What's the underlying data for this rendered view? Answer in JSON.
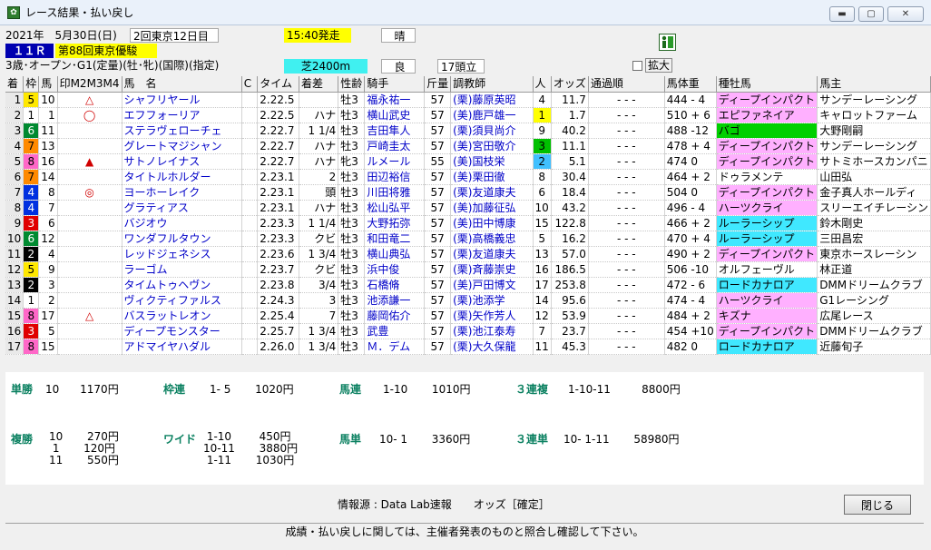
{
  "window": {
    "title": "レース結果・払い戻し",
    "min": "▬",
    "max": "▢",
    "close": "✕"
  },
  "race": {
    "date": "2021年　5月30日(日)",
    "meeting": "2回東京12日目",
    "start": "15:40発走",
    "weather": "晴",
    "race_no": "１１Ｒ",
    "race_name": "第88回東京優駿",
    "conditions": "3歳･オープン･G1(定量)(牡･牝)(国際)(指定)",
    "course": "芝2400m",
    "going": "良",
    "runners": "17頭立",
    "rank_label": "拡大"
  },
  "colors": {
    "gate1": "#ffffff",
    "gate2": "#000000",
    "gate3": "#e00000",
    "gate4": "#0030e0",
    "gate5": "#ffe800",
    "gate6": "#008a30",
    "gate7": "#ff8a00",
    "gate8": "#ff68c8"
  },
  "headers": [
    "着",
    "枠",
    "馬",
    "印M2M3M4",
    "馬　名",
    "C",
    "タイム",
    "着差",
    "性齢",
    "騎手",
    "斤量",
    "調教師",
    "人",
    "オッズ",
    "通過順",
    "馬体重",
    "種牡馬",
    "馬主"
  ],
  "rows": [
    {
      "pos": "1",
      "gate": "5",
      "num": "10",
      "mark": "△",
      "name": "シャフリヤール",
      "time": "2.22.5",
      "margin": "",
      "sa": "牡3",
      "jockey": "福永祐一",
      "wt": "57",
      "trainer": "(栗)藤原英昭",
      "pop": "4",
      "odds": "11.7",
      "pass": "-  -  -",
      "body": "444 - 4",
      "sire": "ディープインパクト",
      "sire_color": "#ffb0ff",
      "owner": "サンデーレーシング"
    },
    {
      "pos": "2",
      "gate": "1",
      "num": "1",
      "mark": "◯",
      "name": "エフフォーリア",
      "time": "2.22.5",
      "margin": "ハナ",
      "sa": "牡3",
      "jockey": "横山武史",
      "wt": "57",
      "trainer": "(美)鹿戸雄一",
      "pop": "1",
      "pop_color": "#ffff00",
      "odds": "1.7",
      "pass": "-  -  -",
      "body": "510 + 6",
      "sire": "エピファネイア",
      "sire_color": "#ffb0ff",
      "owner": "キャロットファーム"
    },
    {
      "pos": "3",
      "gate": "6",
      "num": "11",
      "mark": "",
      "name": "ステラヴェローチェ",
      "time": "2.22.7",
      "margin": "1 1/4",
      "sa": "牡3",
      "jockey": "吉田隼人",
      "wt": "57",
      "trainer": "(栗)須貝尚介",
      "pop": "9",
      "odds": "40.2",
      "pass": "-  -  -",
      "body": "488 -12",
      "sire": "バゴ",
      "sire_color": "#00d000",
      "owner": "大野剛嗣"
    },
    {
      "pos": "4",
      "gate": "7",
      "num": "13",
      "mark": "",
      "name": "グレートマジシャン",
      "time": "2.22.7",
      "margin": "ハナ",
      "sa": "牡3",
      "jockey": "戸崎圭太",
      "wt": "57",
      "trainer": "(美)宮田敬介",
      "pop": "3",
      "pop_color": "#00c000",
      "odds": "11.1",
      "pass": "-  -  -",
      "body": "478 + 4",
      "sire": "ディープインパクト",
      "sire_color": "#ffb0ff",
      "owner": "サンデーレーシング"
    },
    {
      "pos": "5",
      "gate": "8",
      "num": "16",
      "mark": "▲",
      "name": "サトノレイナス",
      "time": "2.22.7",
      "margin": "ハナ",
      "sa": "牝3",
      "jockey": "ルメール",
      "wt": "55",
      "trainer": "(美)国枝栄",
      "pop": "2",
      "pop_color": "#40c0ff",
      "odds": "5.1",
      "pass": "-  -  -",
      "body": "474   0",
      "sire": "ディープインパクト",
      "sire_color": "#ffb0ff",
      "owner": "サトミホースカンパニ"
    },
    {
      "pos": "6",
      "gate": "7",
      "num": "14",
      "mark": "",
      "name": "タイトルホルダー",
      "time": "2.23.1",
      "margin": "2",
      "sa": "牡3",
      "jockey": "田辺裕信",
      "wt": "57",
      "trainer": "(美)栗田徹",
      "pop": "8",
      "odds": "30.4",
      "pass": "-  -  -",
      "body": "464 + 2",
      "sire": "ドゥラメンテ",
      "sire_color": "#ffffff",
      "owner": "山田弘"
    },
    {
      "pos": "7",
      "gate": "4",
      "num": "8",
      "mark": "◎",
      "name": "ヨーホーレイク",
      "time": "2.23.1",
      "margin": "頭",
      "sa": "牡3",
      "jockey": "川田将雅",
      "wt": "57",
      "trainer": "(栗)友道康夫",
      "pop": "6",
      "odds": "18.4",
      "pass": "-  -  -",
      "body": "504   0",
      "sire": "ディープインパクト",
      "sire_color": "#ffb0ff",
      "owner": "金子真人ホールディ"
    },
    {
      "pos": "8",
      "gate": "4",
      "num": "7",
      "mark": "",
      "name": "グラティアス",
      "time": "2.23.1",
      "margin": "ハナ",
      "sa": "牡3",
      "jockey": "松山弘平",
      "wt": "57",
      "trainer": "(美)加藤征弘",
      "pop": "10",
      "odds": "43.2",
      "pass": "-  -  -",
      "body": "496 - 4",
      "sire": "ハーツクライ",
      "sire_color": "#ffb0ff",
      "owner": "スリーエイチレーシン"
    },
    {
      "pos": "9",
      "gate": "3",
      "num": "6",
      "mark": "",
      "name": "バジオウ",
      "time": "2.23.3",
      "margin": "1 1/4",
      "sa": "牡3",
      "jockey": "大野拓弥",
      "wt": "57",
      "trainer": "(美)田中博康",
      "pop": "15",
      "odds": "122.8",
      "pass": "-  -  -",
      "body": "466 + 2",
      "sire": "ルーラーシップ",
      "sire_color": "#40e8ff",
      "owner": "鈴木剛史"
    },
    {
      "pos": "10",
      "gate": "6",
      "num": "12",
      "mark": "",
      "name": "ワンダフルタウン",
      "time": "2.23.3",
      "margin": "クビ",
      "sa": "牡3",
      "jockey": "和田竜二",
      "wt": "57",
      "trainer": "(栗)高橋義忠",
      "pop": "5",
      "odds": "16.2",
      "pass": "-  -  -",
      "body": "470 + 4",
      "sire": "ルーラーシップ",
      "sire_color": "#40e8ff",
      "owner": "三田昌宏"
    },
    {
      "pos": "11",
      "gate": "2",
      "num": "4",
      "mark": "",
      "name": "レッドジェネシス",
      "time": "2.23.6",
      "margin": "1 3/4",
      "sa": "牡3",
      "jockey": "横山典弘",
      "wt": "57",
      "trainer": "(栗)友道康夫",
      "pop": "13",
      "odds": "57.0",
      "pass": "-  -  -",
      "body": "490 + 2",
      "sire": "ディープインパクト",
      "sire_color": "#ffb0ff",
      "owner": "東京ホースレーシン"
    },
    {
      "pos": "12",
      "gate": "5",
      "num": "9",
      "mark": "",
      "name": "ラーゴム",
      "time": "2.23.7",
      "margin": "クビ",
      "sa": "牡3",
      "jockey": "浜中俊",
      "wt": "57",
      "trainer": "(栗)斉藤崇史",
      "pop": "16",
      "odds": "186.5",
      "pass": "-  -  -",
      "body": "506 -10",
      "sire": "オルフェーヴル",
      "sire_color": "#ffffff",
      "owner": "林正道"
    },
    {
      "pos": "13",
      "gate": "2",
      "num": "3",
      "mark": "",
      "name": "タイムトゥヘヴン",
      "time": "2.23.8",
      "margin": "3/4",
      "sa": "牡3",
      "jockey": "石橋脩",
      "wt": "57",
      "trainer": "(美)戸田博文",
      "pop": "17",
      "odds": "253.8",
      "pass": "-  -  -",
      "body": "472 - 6",
      "sire": "ロードカナロア",
      "sire_color": "#40e8ff",
      "owner": "DMMドリームクラブ"
    },
    {
      "pos": "14",
      "gate": "1",
      "num": "2",
      "mark": "",
      "name": "ヴィクティファルス",
      "time": "2.24.3",
      "margin": "3",
      "sa": "牡3",
      "jockey": "池添謙一",
      "wt": "57",
      "trainer": "(栗)池添学",
      "pop": "14",
      "odds": "95.6",
      "pass": "-  -  -",
      "body": "474 - 4",
      "sire": "ハーツクライ",
      "sire_color": "#ffb0ff",
      "owner": "G1レーシング"
    },
    {
      "pos": "15",
      "gate": "8",
      "num": "17",
      "mark": "△",
      "name": "バスラットレオン",
      "time": "2.25.4",
      "margin": "7",
      "sa": "牡3",
      "jockey": "藤岡佑介",
      "wt": "57",
      "trainer": "(栗)矢作芳人",
      "pop": "12",
      "odds": "53.9",
      "pass": "-  -  -",
      "body": "484 + 2",
      "sire": "キズナ",
      "sire_color": "#ffb0ff",
      "owner": "広尾レース"
    },
    {
      "pos": "16",
      "gate": "3",
      "num": "5",
      "mark": "",
      "name": "ディープモンスター",
      "time": "2.25.7",
      "margin": "1 3/4",
      "sa": "牡3",
      "jockey": "武豊",
      "wt": "57",
      "trainer": "(栗)池江泰寿",
      "pop": "7",
      "odds": "23.7",
      "pass": "-  -  -",
      "body": "454 +10",
      "sire": "ディープインパクト",
      "sire_color": "#ffb0ff",
      "owner": "DMMドリームクラブ"
    },
    {
      "pos": "17",
      "gate": "8",
      "num": "15",
      "mark": "",
      "name": "アドマイヤハダル",
      "time": "2.26.0",
      "margin": "1 3/4",
      "sa": "牡3",
      "jockey": "Ｍ．デム",
      "wt": "57",
      "trainer": "(栗)大久保龍",
      "pop": "11",
      "odds": "45.3",
      "pass": "-  -  -",
      "body": "482   0",
      "sire": "ロードカナロア",
      "sire_color": "#40e8ff",
      "owner": "近藤旬子"
    }
  ],
  "payout": {
    "tansho": {
      "label": "単勝",
      "lines": "10      1170円"
    },
    "wakuren": {
      "label": "枠連",
      "lines": "1- 5       1020円"
    },
    "umaren": {
      "label": "馬連",
      "lines": "1-10       1010円"
    },
    "sanrenpuku": {
      "label": "３連複",
      "lines": "1-10-11         8800円"
    },
    "fukusho": {
      "label": "複勝",
      "lines": "10       270円\n 1       120円\n11       550円"
    },
    "wide": {
      "label": "ワイド",
      "lines": " 1-10        450円\n10-11       3880円\n 1-11       1030円"
    },
    "umatan": {
      "label": "馬単",
      "lines": "10- 1       3360円"
    },
    "sanrentan": {
      "label": "３連単",
      "lines": "10- 1-11       58980円"
    }
  },
  "source": "情報源 : Data Lab速報　　オッズ［確定］",
  "close_label": "閉じる",
  "status": "成績・払い戻しに関しては、主催者発表のものと照合し確認して下さい。"
}
